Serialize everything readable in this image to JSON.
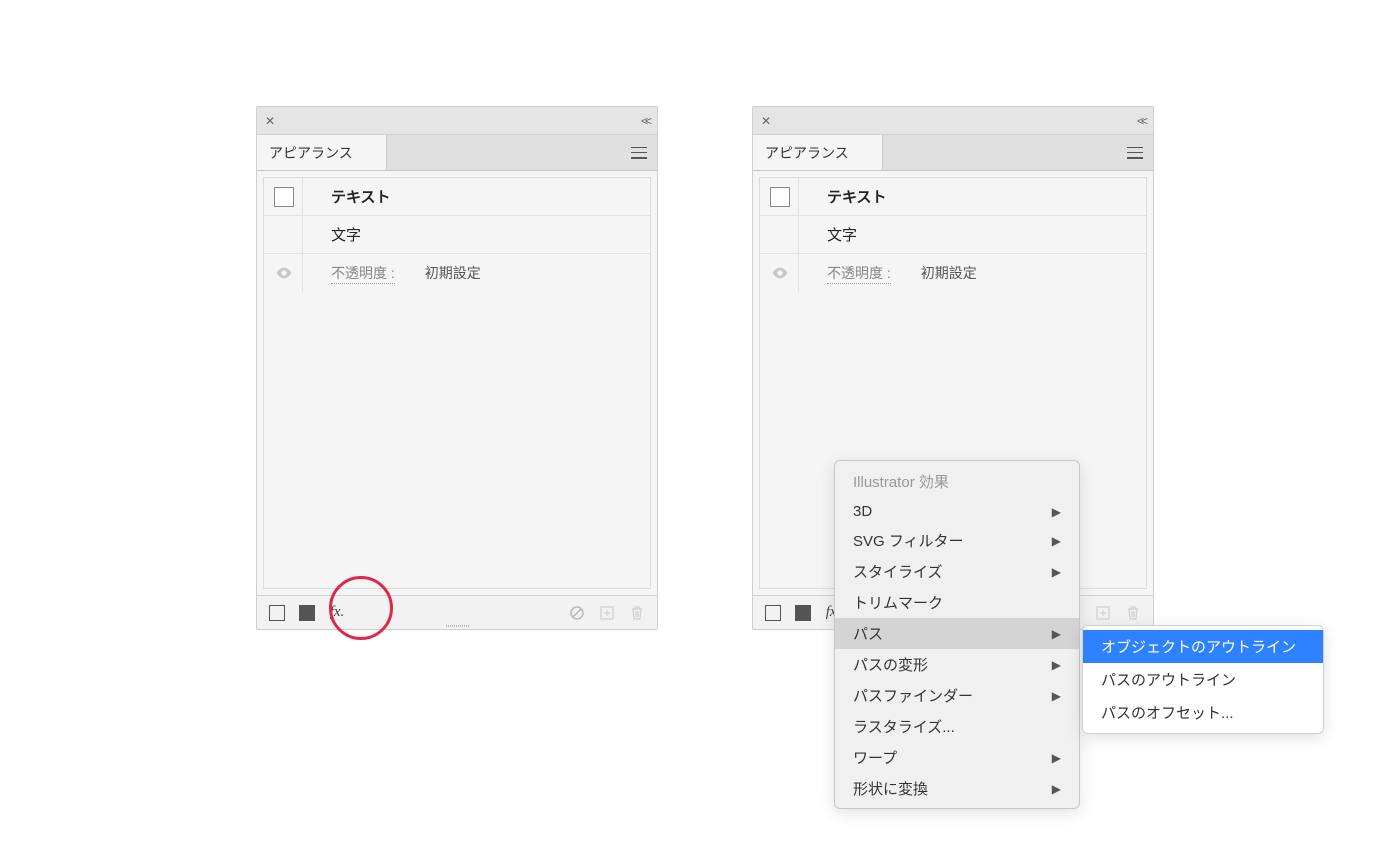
{
  "panel": {
    "tab_label": "アピアランス",
    "item_title": "テキスト",
    "char_label": "文字",
    "opacity_label": "不透明度 :",
    "opacity_value": "初期設定",
    "fx_label": "fx."
  },
  "menu": {
    "header": "Illustrator 効果",
    "items": [
      {
        "label": "3D",
        "has_submenu": true
      },
      {
        "label": "SVG フィルター",
        "has_submenu": true
      },
      {
        "label": "スタイライズ",
        "has_submenu": true
      },
      {
        "label": "トリムマーク",
        "has_submenu": false
      },
      {
        "label": "パス",
        "has_submenu": true,
        "hover": true
      },
      {
        "label": "パスの変形",
        "has_submenu": true
      },
      {
        "label": "パスファインダー",
        "has_submenu": true
      },
      {
        "label": "ラスタライズ...",
        "has_submenu": false
      },
      {
        "label": "ワープ",
        "has_submenu": true
      },
      {
        "label": "形状に変換",
        "has_submenu": true
      }
    ]
  },
  "submenu": {
    "items": [
      {
        "label": "オブジェクトのアウトライン",
        "selected": true
      },
      {
        "label": "パスのアウトライン",
        "selected": false
      },
      {
        "label": "パスのオフセット...",
        "selected": false
      }
    ]
  }
}
